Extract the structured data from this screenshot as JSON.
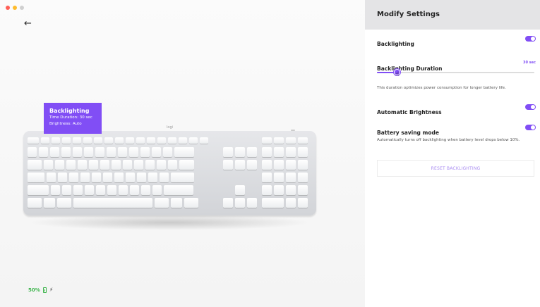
{
  "window": {
    "dot_colors": [
      "#ff5f57",
      "#febc2e",
      "#d0d0d0"
    ]
  },
  "nav": {
    "back_glyph": "←"
  },
  "tooltip": {
    "title": "Backlighting",
    "time_duration": "Time Duration: 30 sec",
    "brightness": "Brightness: Auto"
  },
  "keyboard": {
    "logo": "logi"
  },
  "battery": {
    "level": "50%",
    "icon": "battery-icon",
    "plug_icon": "plug-icon",
    "plug_glyph": "⚡"
  },
  "panel": {
    "title": "Modify Settings",
    "backlighting": {
      "label": "Backlighting",
      "enabled": true
    },
    "duration": {
      "label": "Backlighting Duration",
      "value": "30 sec",
      "slider_fraction": 0.13,
      "description": "This duration optimizes power consumption for longer battery life."
    },
    "auto_brightness": {
      "label": "Automatic Brightness",
      "enabled": true
    },
    "battery_saving": {
      "label": "Battery saving mode",
      "enabled": true,
      "description": "Automatically turns off backlighting when battery level drops below 10%."
    },
    "reset_label": "RESET BACKLIGHTING"
  },
  "colors": {
    "accent": "#814ef5",
    "battery": "#3cb44b"
  }
}
